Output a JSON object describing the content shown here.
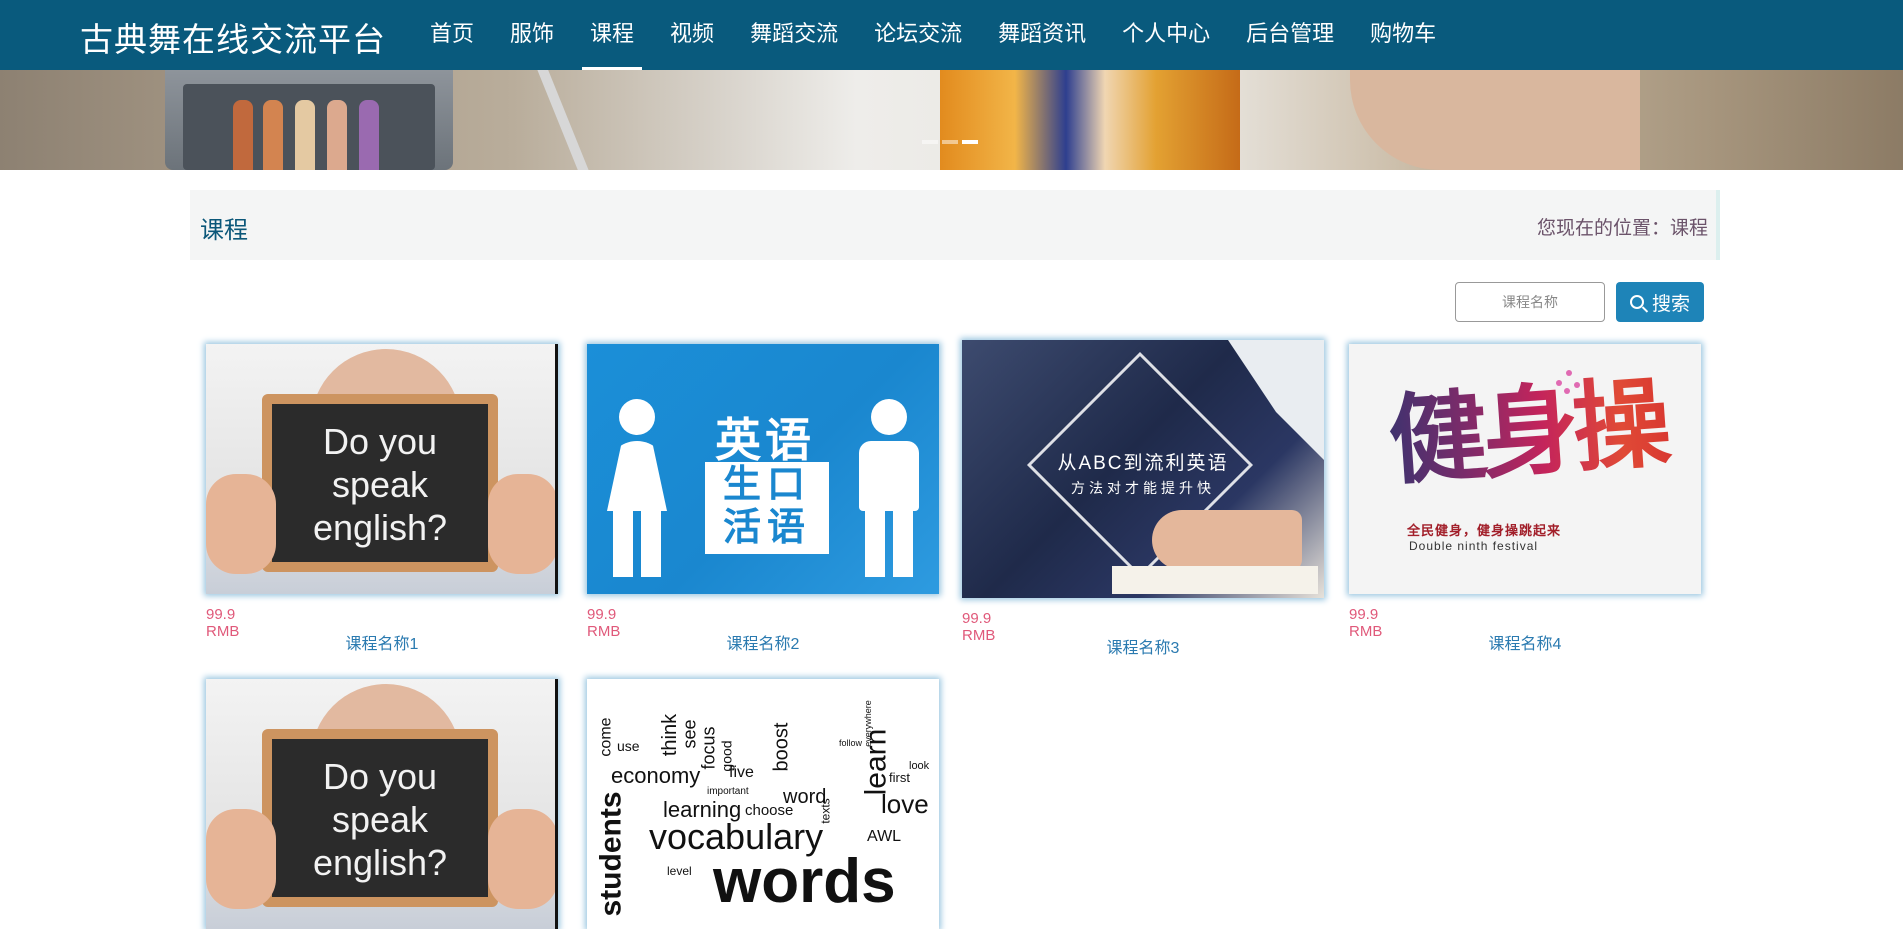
{
  "site": {
    "title": "古典舞在线交流平台"
  },
  "nav": {
    "items": [
      {
        "label": "首页",
        "icon": ""
      },
      {
        "label": "服饰"
      },
      {
        "label": "课程",
        "active": true
      },
      {
        "label": "视频"
      },
      {
        "label": "舞蹈交流"
      },
      {
        "label": "论坛交流"
      },
      {
        "label": "舞蹈资讯"
      },
      {
        "label": "个人中心"
      },
      {
        "label": "后台管理"
      },
      {
        "label": "购物车"
      }
    ]
  },
  "banner": {
    "slides": 3,
    "active_slide": 2
  },
  "page": {
    "title": "课程",
    "breadcrumb": "您现在的位置：课程"
  },
  "search": {
    "placeholder": "课程名称",
    "button_label": "搜索",
    "button_icon": "search-icon"
  },
  "courses": [
    {
      "price": "99.9 RMB",
      "name": "课程名称1",
      "image_text": "Do you speak english?"
    },
    {
      "price": "99.9 RMB",
      "name": "课程名称2",
      "image_title": "英语",
      "image_box": "生口 活语"
    },
    {
      "price": "99.9 RMB",
      "name": "课程名称3",
      "image_title": "从ABC到流利英语",
      "image_sub": "方法对才能提升快"
    },
    {
      "price": "99.9 RMB",
      "name": "课程名称4",
      "image_art": "健身操",
      "image_title": "全民健身，健身操跳起来",
      "image_sub": "Double ninth festival"
    },
    {
      "image_text": "Do you speak english?"
    },
    {
      "image_words": [
        "vocabulary",
        "words",
        "students",
        "economy",
        "learning",
        "focus",
        "learn",
        "love",
        "boost",
        "word",
        "choose",
        "important",
        "five",
        "good",
        "think",
        "see",
        "use",
        "come",
        "level",
        "AWL",
        "first",
        "look",
        "everywhere",
        "follow",
        "texts"
      ]
    }
  ],
  "colors": {
    "topbar": "#095a7d",
    "accent": "#1e84b8",
    "price": "#e0597a",
    "course_name": "#2a7ab0"
  }
}
